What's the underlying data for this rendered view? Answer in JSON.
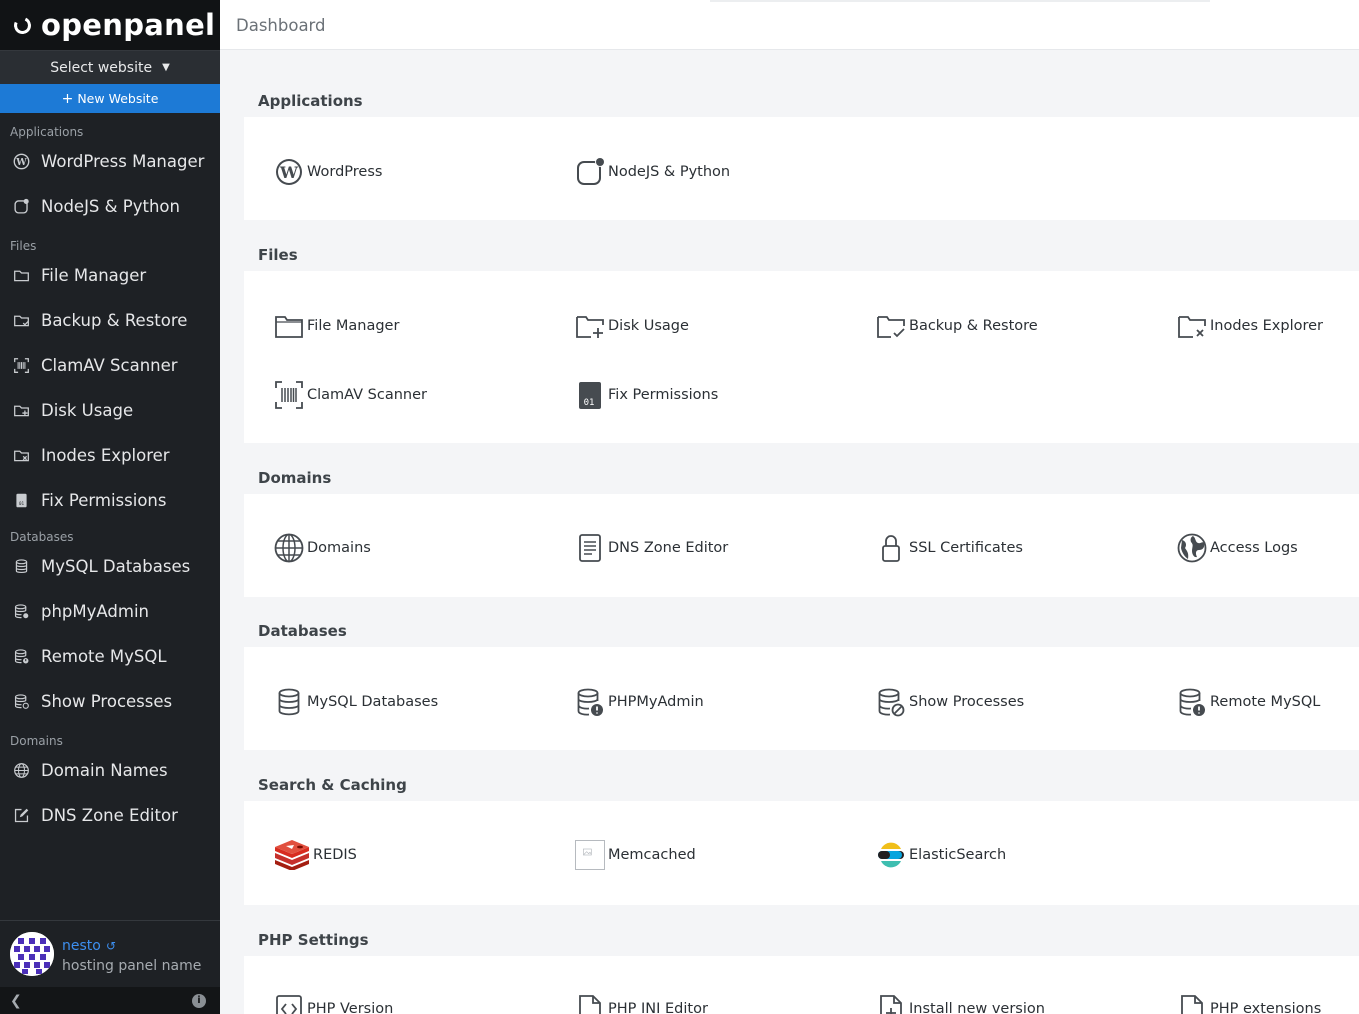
{
  "brand": {
    "name": "openpanel"
  },
  "sidebar": {
    "select_website": "Select website",
    "new_website": "New Website",
    "sections": [
      {
        "title": "Applications",
        "items": [
          {
            "label": "WordPress Manager",
            "icon": "wordpress-icon"
          },
          {
            "label": "NodeJS & Python",
            "icon": "nodejs-icon"
          }
        ]
      },
      {
        "title": "Files",
        "items": [
          {
            "label": "File Manager",
            "icon": "folder-icon"
          },
          {
            "label": "Backup & Restore",
            "icon": "folder-check-icon"
          },
          {
            "label": "ClamAV Scanner",
            "icon": "barcode-icon"
          },
          {
            "label": "Disk Usage",
            "icon": "folder-plus-icon"
          },
          {
            "label": "Inodes Explorer",
            "icon": "folder-x-icon"
          },
          {
            "label": "Fix Permissions",
            "icon": "binary-file-icon"
          }
        ]
      },
      {
        "title": "Databases",
        "items": [
          {
            "label": "MySQL Databases",
            "icon": "database-icon"
          },
          {
            "label": "phpMyAdmin",
            "icon": "database-gear-icon"
          },
          {
            "label": "Remote MySQL",
            "icon": "database-alert-icon"
          },
          {
            "label": "Show Processes",
            "icon": "database-check-icon"
          }
        ]
      },
      {
        "title": "Domains",
        "items": [
          {
            "label": "Domain Names",
            "icon": "globe-icon"
          },
          {
            "label": "DNS Zone Editor",
            "icon": "edit-icon"
          }
        ]
      }
    ],
    "user": {
      "name": "nesto",
      "subtitle": "hosting panel name"
    }
  },
  "header": {
    "title": "Dashboard"
  },
  "cards": [
    {
      "title": "Applications",
      "tiles": [
        {
          "label": "WordPress",
          "icon": "wordpress-icon"
        },
        {
          "label": "NodeJS & Python",
          "icon": "nodejs-icon"
        }
      ]
    },
    {
      "title": "Files",
      "tiles": [
        {
          "label": "File Manager",
          "icon": "folder-icon"
        },
        {
          "label": "Disk Usage",
          "icon": "folder-plus-icon"
        },
        {
          "label": "Backup & Restore",
          "icon": "folder-check-icon"
        },
        {
          "label": "Inodes Explorer",
          "icon": "folder-x-icon"
        },
        {
          "label": "ClamAV Scanner",
          "icon": "barcode-icon"
        },
        {
          "label": "Fix Permissions",
          "icon": "binary-file-icon"
        }
      ]
    },
    {
      "title": "Domains",
      "tiles": [
        {
          "label": "Domains",
          "icon": "globe-icon"
        },
        {
          "label": "DNS Zone Editor",
          "icon": "document-icon"
        },
        {
          "label": "SSL Certificates",
          "icon": "lock-icon"
        },
        {
          "label": "Access Logs",
          "icon": "earth-icon"
        }
      ]
    },
    {
      "title": "Databases",
      "tiles": [
        {
          "label": "MySQL Databases",
          "icon": "database-icon"
        },
        {
          "label": "PHPMyAdmin",
          "icon": "database-alert-icon"
        },
        {
          "label": "Show Processes",
          "icon": "database-block-icon"
        },
        {
          "label": "Remote MySQL",
          "icon": "database-alert-icon"
        }
      ]
    },
    {
      "title": "Search & Caching",
      "tiles": [
        {
          "label": "REDIS",
          "icon": "redis-icon"
        },
        {
          "label": "Memcached",
          "icon": "memcached-icon"
        },
        {
          "label": "ElasticSearch",
          "icon": "elasticsearch-icon"
        }
      ]
    },
    {
      "title": "PHP Settings",
      "tiles": [
        {
          "label": "PHP Version",
          "icon": "code-file-icon"
        },
        {
          "label": "PHP INI Editor",
          "icon": "file-icon"
        },
        {
          "label": "Install new version",
          "icon": "file-plus-icon"
        },
        {
          "label": "PHP extensions",
          "icon": "file-icon"
        }
      ]
    }
  ],
  "colors": {
    "sidebar_bg": "#1e2125",
    "accent": "#1d7ad6",
    "link": "#3d8ff0"
  }
}
